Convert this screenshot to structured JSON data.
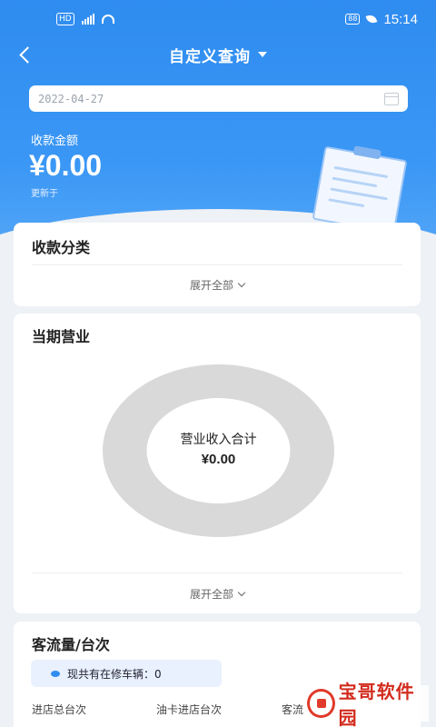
{
  "status_bar": {
    "network_badge": "HD",
    "network_type": "5G",
    "battery": "88",
    "time": "15:14",
    "icons": [
      "signal-icon",
      "wifi-icon",
      "battery-icon",
      "leaf-icon"
    ]
  },
  "nav": {
    "title": "自定义查询",
    "back_icon": "back-arrow-icon",
    "dropdown_icon": "caret-down-icon"
  },
  "date_filter": {
    "value": "2022-04-27",
    "icon": "calendar-icon"
  },
  "summary": {
    "label": "收款金额",
    "amount": "¥0.00",
    "updated_label": "更新于"
  },
  "payment_category": {
    "title": "收款分类",
    "expand_label": "展开全部"
  },
  "current_business": {
    "title": "当期营业",
    "donut_label": "营业收入合计",
    "donut_value": "¥0.00",
    "expand_label": "展开全部"
  },
  "traffic": {
    "title": "客流量/台次",
    "notice": "现共有在修车辆：0",
    "columns": [
      "进店总台次",
      "油卡进店台次",
      "客流"
    ]
  },
  "watermark": {
    "text": "宝哥软件园"
  },
  "colors": {
    "primary": "#2f8cf0",
    "background": "#eef1f5",
    "donut": "#d9d9d9",
    "watermark": "#d22c1e"
  }
}
